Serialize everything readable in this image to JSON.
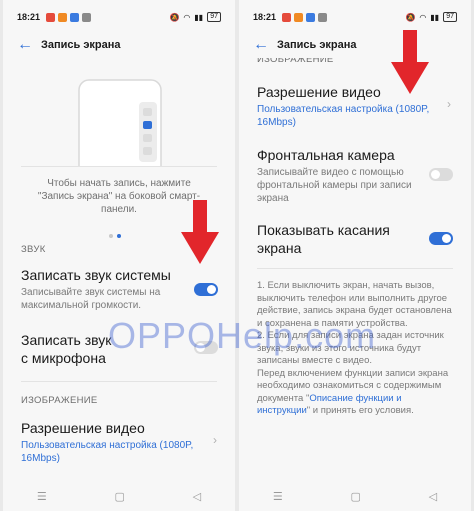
{
  "status": {
    "time": "18:21",
    "battery": "97"
  },
  "colors": {
    "accent": "#2f6fd6",
    "arrow": "#e2262b",
    "watermark": "#3a5fd0"
  },
  "left": {
    "title": "Запись экрана",
    "hint": "Чтобы начать запись, нажмите \"Запись экрана\" на боковой смарт-панели.",
    "sound_section": "ЗВУК",
    "system_sound": {
      "title": "Записать звук системы",
      "subtitle": "Записывайте звук системы на максимальной громкости.",
      "enabled": true
    },
    "mic_sound": {
      "title": "Записать звук с микрофона",
      "enabled": false
    },
    "image_section": "ИЗОБРАЖЕНИЕ",
    "resolution": {
      "title": "Разрешение видео",
      "value": "Пользовательская настройка (1080P, 16Mbps)"
    }
  },
  "right": {
    "title": "Запись экрана",
    "image_section": "ИЗОБРАЖЕНИЕ",
    "resolution": {
      "title": "Разрешение видео",
      "value": "Пользовательская настройка (1080P, 16Mbps)"
    },
    "front_camera": {
      "title": "Фронтальная камера",
      "subtitle": "Записывайте видео с помощью фронтальной камеры при записи экрана",
      "enabled": false
    },
    "show_touches": {
      "title": "Показывать касания экрана",
      "enabled": true
    },
    "notes_1": "1. Если выключить экран, начать вызов, выключить телефон или выполнить другое действие, запись экрана будет остановлена и сохранена в памяти устройства.",
    "notes_2": "2. Если для записи экрана задан источник звука, звуки из этого источника будут записаны вместе с видео.",
    "notes_3_before": "Перед включением функции записи экрана необходимо ознакомиться с содержимым документа \"",
    "notes_link": "Описание функции и инструкции",
    "notes_3_after": "\" и принять его условия."
  },
  "watermark": "OPPOHelp.com",
  "icons": [
    "back-arrow-icon",
    "chevron-right-icon",
    "red-arrow-down-icon",
    "nav-menu-icon",
    "nav-home-icon",
    "nav-back-icon"
  ]
}
